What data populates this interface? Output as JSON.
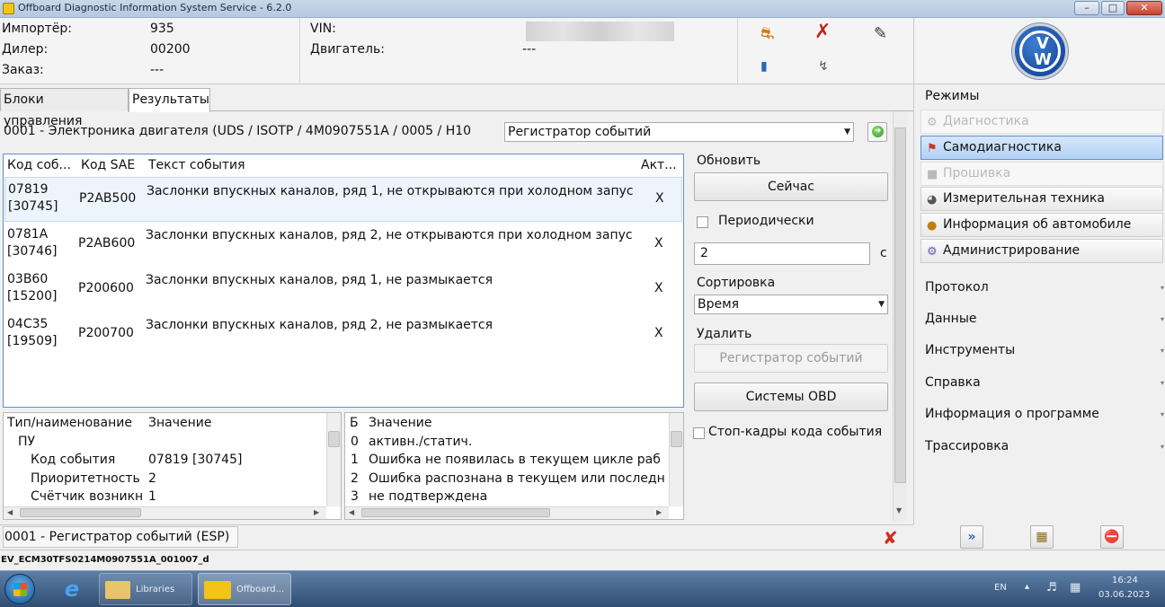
{
  "window": {
    "title": "Offboard Diagnostic Information System Service - 6.2.0"
  },
  "info": {
    "importer_label": "Импортёр:",
    "importer_value": "935",
    "dealer_label": "Дилер:",
    "dealer_value": "00200",
    "order_label": "Заказ:",
    "order_value": "---",
    "vin_label": "VIN:",
    "engine_label": "Двигатель:",
    "engine_value": "---"
  },
  "tabs": [
    "Блоки управления",
    "Результаты"
  ],
  "selector": {
    "module": "0001 - Электроника двигателя  (UDS / ISOTP / 4M0907551A / 0005 / H10",
    "function": "Регистратор событий"
  },
  "events_table": {
    "headers": [
      "Код соб...",
      "Код SAE",
      "Текст события",
      "Акт..."
    ],
    "rows": [
      {
        "code": "07819",
        "code2": "[30745]",
        "sae": "P2AB500",
        "text": "Заслонки впускных каналов, ряд 1, не открываются при холодном запус",
        "active": "X"
      },
      {
        "code": "0781A",
        "code2": "[30746]",
        "sae": "P2AB600",
        "text": "Заслонки впускных каналов, ряд 2, не открываются при холодном запус",
        "active": "X"
      },
      {
        "code": "03B60",
        "code2": "[15200]",
        "sae": "P200600",
        "text": "Заслонки впускных каналов, ряд 1, не размыкается",
        "active": "X"
      },
      {
        "code": "04C35",
        "code2": "[19509]",
        "sae": "P200700",
        "text": "Заслонки впускных каналов, ряд 2, не размыкается",
        "active": "X"
      }
    ]
  },
  "controls": {
    "refresh_label": "Обновить",
    "now_button": "Сейчас",
    "periodic_label": "Периодически",
    "interval_value": "2",
    "interval_unit": "с",
    "sort_label": "Сортировка",
    "sort_value": "Время",
    "delete_label": "Удалить",
    "event_recorder_button": "Регистратор событий",
    "obd_button": "Системы OBD",
    "freeze_frame_label": "Стоп-кадры кода события"
  },
  "detail_left": {
    "headers": [
      "Тип/наименование",
      "Значение"
    ],
    "rows": [
      {
        "name": "ПУ",
        "value": ""
      },
      {
        "name": "Код события",
        "value": "07819 [30745]"
      },
      {
        "name": "Приоритетность",
        "value": "2"
      },
      {
        "name": "Счётчик возникн",
        "value": "1"
      }
    ]
  },
  "detail_right": {
    "headers": [
      "Б",
      "Значение"
    ],
    "rows": [
      {
        "bit": "0",
        "value": "активн./статич."
      },
      {
        "bit": "1",
        "value": "Ошибка не появилась в текущем цикле раб"
      },
      {
        "bit": "2",
        "value": "Ошибка распознана в текущем или последн"
      },
      {
        "bit": "3",
        "value": "не подтверждена"
      }
    ]
  },
  "status": {
    "text": "0001 - Регистратор событий (ESP)",
    "file": "EV_ECM30TFS0214M0907551A_001007_d"
  },
  "nav": {
    "modes_label": "Режимы",
    "items": [
      {
        "label": "Диагностика",
        "state": "disabled",
        "icon": "diagnostics-icon"
      },
      {
        "label": "Самодиагностика",
        "state": "active",
        "icon": "self-diagnosis-icon"
      },
      {
        "label": "Прошивка",
        "state": "disabled",
        "icon": "flash-icon"
      },
      {
        "label": "Измерительная техника",
        "state": "normal",
        "icon": "measuring-icon"
      },
      {
        "label": "Информация об автомобиле",
        "state": "normal",
        "icon": "vehicle-info-icon"
      },
      {
        "label": "Администрирование",
        "state": "normal",
        "icon": "admin-icon"
      }
    ],
    "sections": [
      "Протокол",
      "Данные",
      "Инструменты",
      "Справка",
      "Информация о программе",
      "Трассировка"
    ]
  },
  "taskbar": {
    "libraries": "Libraries",
    "offboard": "Offboard...",
    "lang": "EN",
    "time": "16:24",
    "date": "03.06.2023"
  },
  "colors": {
    "accent": "#5d8fd3",
    "title_bar": "#c9d8ea",
    "vw_blue": "#0c3a8c",
    "error_red": "#d42a1a"
  }
}
